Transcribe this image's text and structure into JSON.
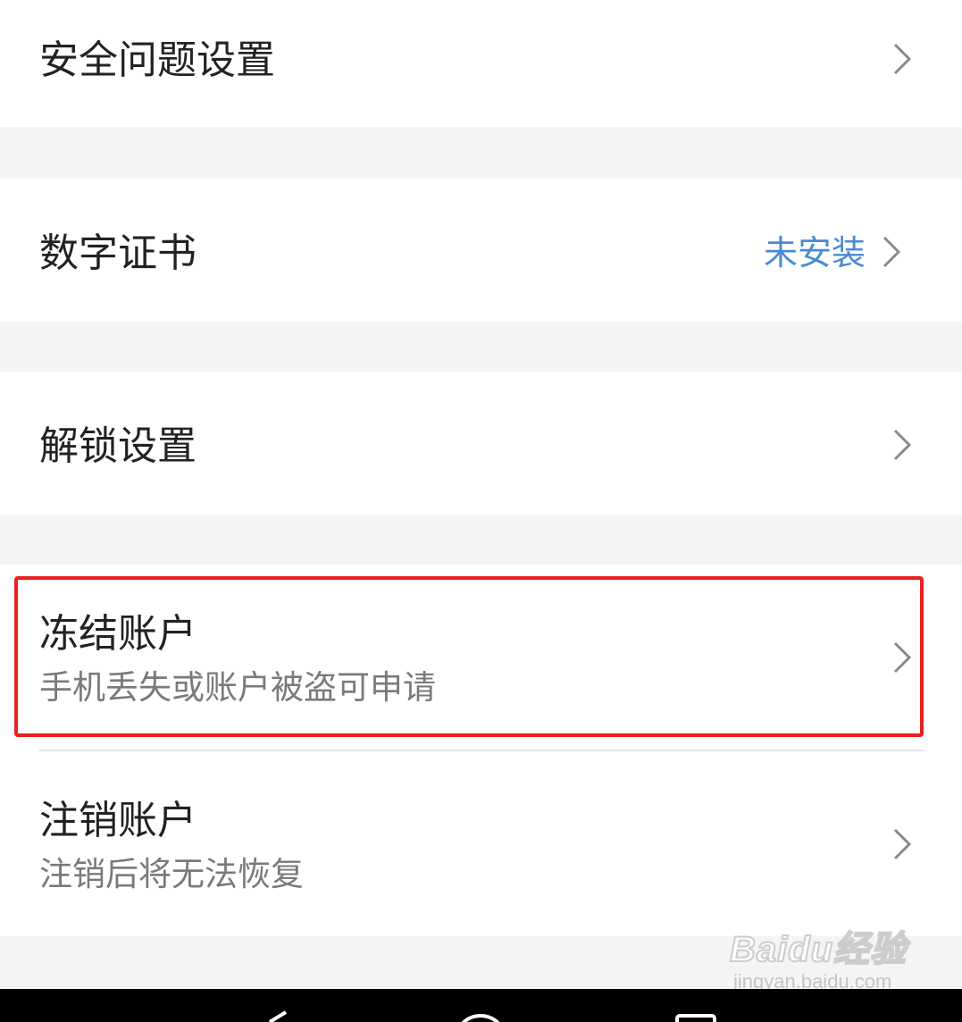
{
  "rows": [
    {
      "title": "安全问题设置"
    },
    {
      "title": "数字证书",
      "value": "未安装"
    },
    {
      "title": "解锁设置"
    },
    {
      "title": "冻结账户",
      "subtitle": "手机丢失或账户被盗可申请"
    },
    {
      "title": "注销账户",
      "subtitle": "注销后将无法恢复"
    }
  ],
  "colors": {
    "accent_value": "#4a8bd0",
    "highlight_border": "#e82020",
    "background": "#f4f4f4"
  },
  "icons": {
    "chevron": "chevron-right-icon",
    "nav_back": "back-triangle-icon",
    "nav_home": "home-circle-icon",
    "nav_recents": "recents-square-icon"
  },
  "watermark": {
    "logo": "Baidu经验",
    "url": "jingyan.baidu.com"
  }
}
